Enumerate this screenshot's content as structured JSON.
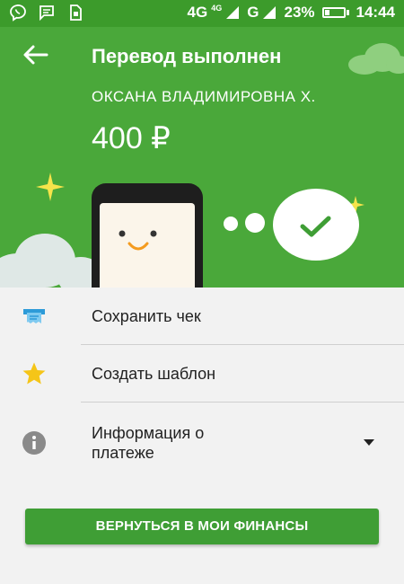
{
  "statusbar": {
    "network_1": "4G",
    "network_1_small": "4G",
    "network_2": "G",
    "battery": "23%",
    "time": "14:44",
    "icons": [
      "viber-icon",
      "message-icon",
      "sim-icon"
    ],
    "battery_level": 0.23
  },
  "header": {
    "title": "Перевод выполнен",
    "recipient": "ОКСАНА ВЛАДИМИРОВНА Х.",
    "amount": "400 ₽",
    "background": "#4aa83a"
  },
  "menu": {
    "items": [
      {
        "label": "Сохранить чек",
        "icon": "receipt-icon"
      },
      {
        "label": "Создать шаблон",
        "icon": "star-icon"
      },
      {
        "label": "Информация о\nплатеже",
        "icon": "info-icon"
      }
    ]
  },
  "actions": {
    "return_label": "ВЕРНУТЬСЯ В МОИ ФИНАНСЫ",
    "accent": "#3f9e35"
  }
}
